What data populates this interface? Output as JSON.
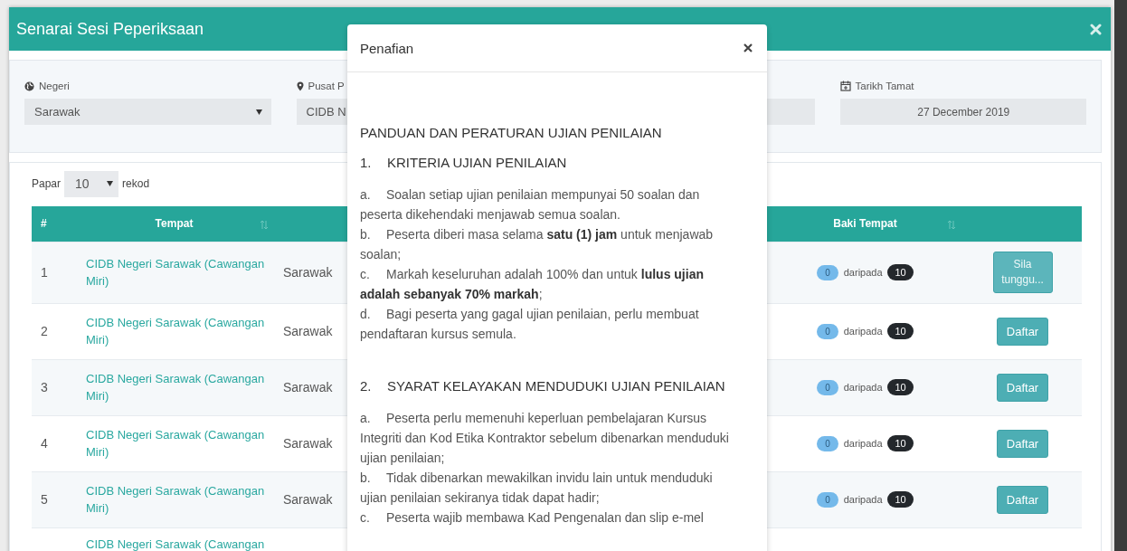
{
  "window": {
    "title": "Senarai Sesi Peperiksaan"
  },
  "filters": [
    {
      "kind": "dropdown",
      "label": "Negeri",
      "value": "Sarawak"
    },
    {
      "kind": "text",
      "label": "Pusat P",
      "value": "CIDB N"
    },
    {
      "kind": "blank"
    },
    {
      "kind": "date",
      "label": "Tarikh Tamat",
      "value": "27 December 2019"
    }
  ],
  "page_length": {
    "label_before": "Papar",
    "value": "10",
    "label_after": "rekod"
  },
  "table": {
    "columns": [
      {
        "label": "#",
        "sortable": false
      },
      {
        "label": "Tempat",
        "sortable": true
      },
      {
        "label": "Baki Tempat",
        "sortable": true
      }
    ],
    "rows": [
      {
        "no": "1",
        "tempat": "CIDB Negeri Sarawak (Cawangan Miri)",
        "negeri": "Sarawak",
        "available": "0",
        "of": "daripada",
        "total": "10",
        "action": "Sila tunggu...",
        "disabled": true
      },
      {
        "no": "2",
        "tempat": "CIDB Negeri Sarawak (Cawangan Miri)",
        "negeri": "Sarawak",
        "available": "0",
        "of": "daripada",
        "total": "10",
        "action": "Daftar",
        "disabled": false
      },
      {
        "no": "3",
        "tempat": "CIDB Negeri Sarawak (Cawangan Miri)",
        "negeri": "Sarawak",
        "available": "0",
        "of": "daripada",
        "total": "10",
        "action": "Daftar",
        "disabled": false
      },
      {
        "no": "4",
        "tempat": "CIDB Negeri Sarawak (Cawangan Miri)",
        "negeri": "Sarawak",
        "available": "0",
        "of": "daripada",
        "total": "10",
        "action": "Daftar",
        "disabled": false
      },
      {
        "no": "5",
        "tempat": "CIDB Negeri Sarawak (Cawangan Miri)",
        "negeri": "Sarawak",
        "available": "0",
        "of": "daripada",
        "total": "10",
        "action": "Daftar",
        "disabled": false
      },
      {
        "tempat": "CIDB Negeri Sarawak (Cawangan"
      }
    ]
  },
  "dialog": {
    "title": "Penafian",
    "heading": "PANDUAN DAN PERATURAN UJIAN PENILAIAN",
    "sections": [
      {
        "number": "1.",
        "title": "KRITERIA UJIAN PENILAIAN",
        "items": [
          {
            "marker": "a.",
            "text": "Soalan setiap ujian penilaian mempunyai 50 soalan dan peserta dikehendaki menjawab semua soalan."
          },
          {
            "marker": "b.",
            "text": "Peserta diberi masa selama **satu (1) jam** untuk menjawab soalan;"
          },
          {
            "marker": "c.",
            "text": "Markah keseluruhan adalah 100% dan untuk **lulus ujian adalah sebanyak 70% markah**;"
          },
          {
            "marker": "d.",
            "text": "Bagi peserta yang gagal ujian penilaian, perlu membuat pendaftaran kursus semula."
          }
        ]
      },
      {
        "number": "2.",
        "title": "SYARAT KELAYAKAN MENDUDUKI UJIAN PENILAIAN",
        "items": [
          {
            "marker": "a.",
            "text": "Peserta perlu memenuhi keperluan pembelajaran Kursus Integriti dan Kod Etika Kontraktor sebelum dibenarkan menduduki ujian penilaian;"
          },
          {
            "marker": "b.",
            "text": "Tidak dibenarkan mewakilkan invidu lain untuk menduduki ujian penilaian sekiranya tidak dapat hadir;"
          },
          {
            "marker": "c.",
            "text": "Peserta wajib membawa Kad Pengenalan dan slip e-mel"
          }
        ]
      }
    ]
  }
}
